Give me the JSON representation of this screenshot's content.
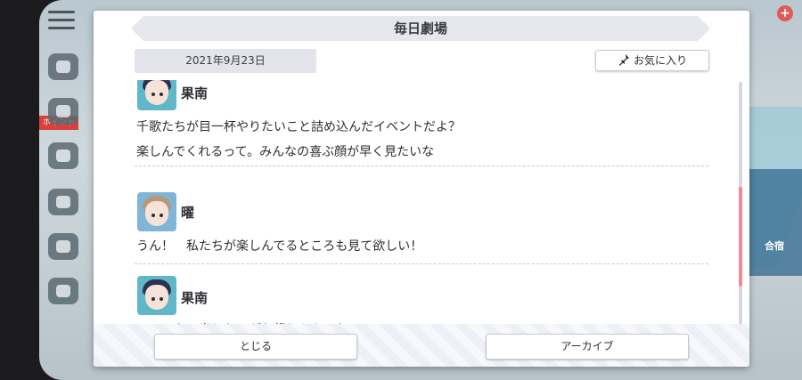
{
  "dialog": {
    "title": "毎日劇場",
    "date": "2021年9月23日",
    "favorite_label": "お気に入り",
    "close_label": "とじる",
    "archive_label": "アーカイブ"
  },
  "entries": [
    {
      "speaker": "果南",
      "avatar": "kanan-avatar",
      "lines": [
        "千歌たちが目一杯やりたいこと詰め込んだイベントだよ？",
        "楽しんでくれるって。みんなの喜ぶ顔が早く見たいな"
      ]
    },
    {
      "speaker": "曜",
      "avatar": "you-avatar",
      "lines": [
        "うん！　私たちが楽しんでるところも見て欲しい！"
      ]
    },
    {
      "speaker": "果南",
      "avatar": "kanan-avatar",
      "lines": [
        "みーんなで楽しむのがお祭りだもんね"
      ]
    }
  ],
  "background": {
    "badge_text": "ポイント",
    "right_label": "合宿"
  },
  "colors": {
    "accent": "#f08a96",
    "title_bar": "#e6e7ec",
    "date_pill": "#e4e4ec"
  },
  "icons": {
    "favorite": "pin-icon",
    "menu": "hamburger-icon",
    "plus": "plus-icon"
  }
}
